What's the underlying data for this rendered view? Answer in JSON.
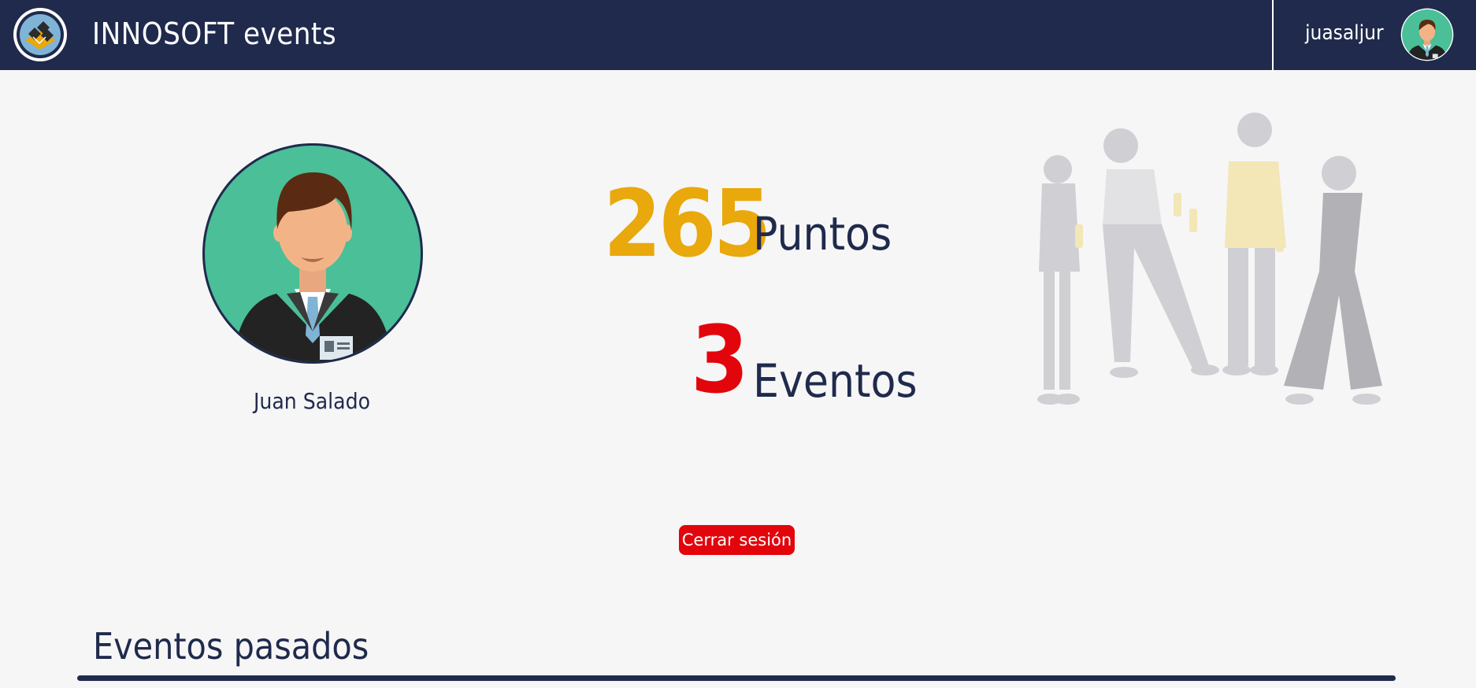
{
  "header": {
    "brand": "INNOSOFT events",
    "username": "juasaljur"
  },
  "profile": {
    "name": "Juan Salado"
  },
  "stats": {
    "points_value": "265",
    "points_label": "Puntos",
    "events_value": "3",
    "events_label": "Eventos"
  },
  "actions": {
    "logout_label": "Cerrar sesión"
  },
  "sections": {
    "past_events_title": "Eventos pasados"
  },
  "colors": {
    "navy": "#1f2a4c",
    "points_gold": "#e9a80b",
    "events_red": "#e3050c",
    "avatar_green": "#4abf98",
    "background": "#f6f6f6"
  },
  "icons": {
    "logo": "logo-icon",
    "nav_avatar": "user-avatar-icon",
    "profile_avatar": "profile-avatar-image",
    "illustration": "party-people-illustration"
  }
}
